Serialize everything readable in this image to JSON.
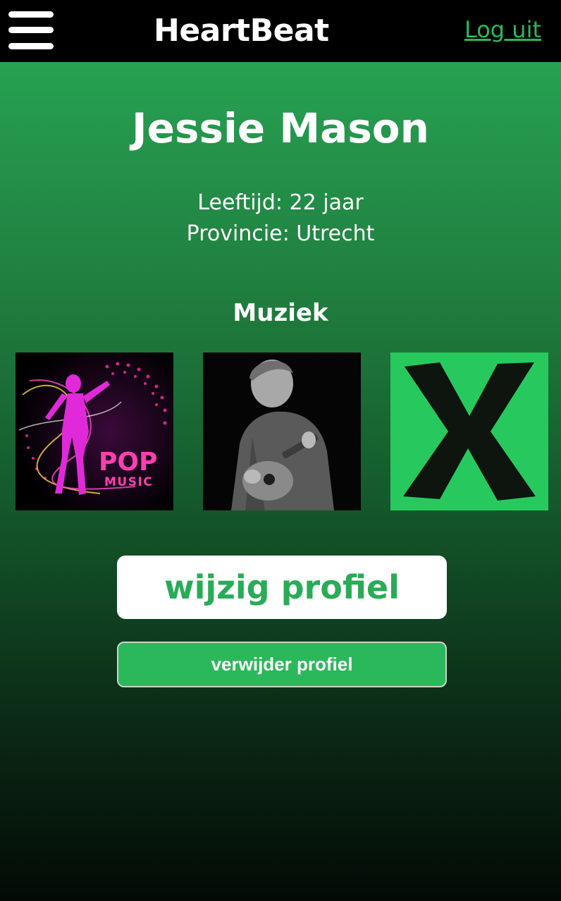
{
  "header": {
    "brand": "HeartBeat",
    "logout_label": "Log uit",
    "menu_icon": "hamburger-menu-icon"
  },
  "profile": {
    "name": "Jessie Mason",
    "age_line": "Leeftijd: 22 jaar",
    "province_line": "Provincie: Utrecht"
  },
  "music": {
    "title": "Muziek",
    "items": [
      {
        "kind": "pop-music-cover",
        "line1": "POP",
        "line2": "MUSIC"
      },
      {
        "kind": "artist-photo-guitar"
      },
      {
        "kind": "album-x-cover"
      }
    ]
  },
  "actions": {
    "edit_label": "wijzig profiel",
    "delete_label": "verwijder profiel"
  },
  "colors": {
    "accent": "#29ab57",
    "topbar": "#000000",
    "text": "#ffffff"
  }
}
